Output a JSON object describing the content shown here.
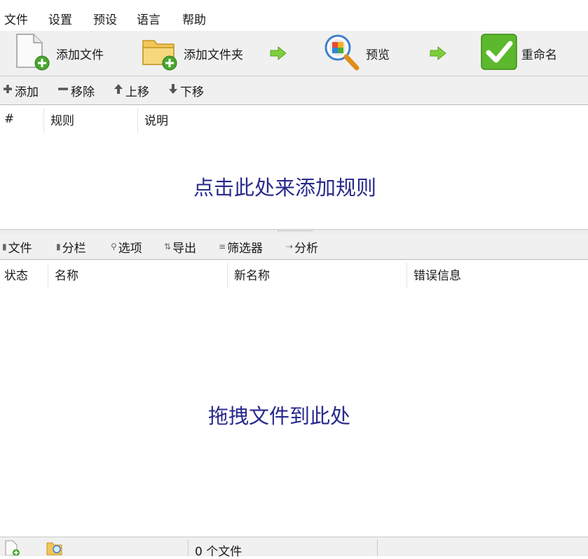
{
  "menu": {
    "file": "文件",
    "settings": "设置",
    "presets": "预设",
    "language": "语言",
    "help": "帮助"
  },
  "toolbar": {
    "add_files": "添加文件",
    "add_folder": "添加文件夹",
    "preview": "预览",
    "rename": "重命名"
  },
  "rules_toolbar": {
    "add": "添加",
    "remove": "移除",
    "move_up": "上移",
    "move_down": "下移"
  },
  "rules_table": {
    "columns": [
      "#",
      "规则",
      "说明"
    ],
    "placeholder": "点击此处来添加规则"
  },
  "files_toolbar": {
    "files": "文件",
    "columns": "分栏",
    "options": "选项",
    "export": "导出",
    "filters": "筛选器",
    "analyze": "分析"
  },
  "files_table": {
    "columns": [
      "状态",
      "名称",
      "新名称",
      "错误信息"
    ],
    "placeholder": "拖拽文件到此处"
  },
  "status_bar": {
    "file_count": "0 个文件"
  },
  "colors": {
    "placeholder_text": "#2a2a8c",
    "arrow_green": "#7ccf3a",
    "rename_green": "#5cb82c"
  }
}
